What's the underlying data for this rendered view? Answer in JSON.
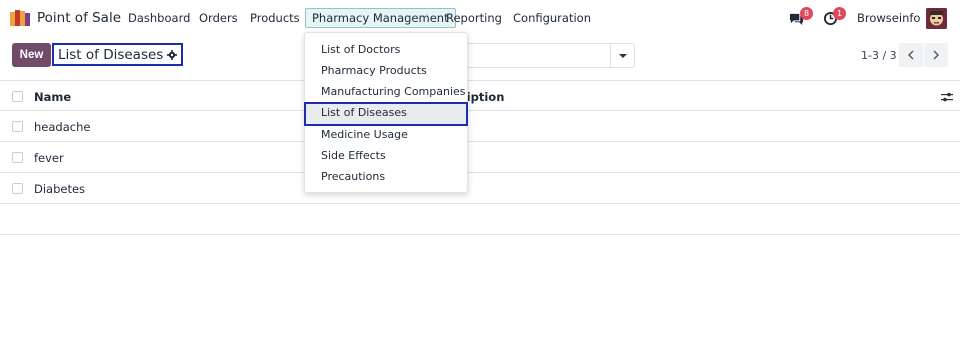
{
  "app": {
    "name": "Point of Sale"
  },
  "menu": {
    "items": [
      "Dashboard",
      "Orders",
      "Products",
      "Pharmacy Management",
      "Reporting",
      "Configuration"
    ],
    "active": "Pharmacy Management"
  },
  "systray": {
    "messages_count": "8",
    "activity_count": "1",
    "user_name": "Browseinfo"
  },
  "control_panel": {
    "new_label": "New",
    "breadcrumb_title": "List of Diseases",
    "search_placeholder": "",
    "pager": "1-3 / 3"
  },
  "list": {
    "columns": [
      "Name",
      "Description"
    ],
    "rows": [
      {
        "name": "headache",
        "description": ""
      },
      {
        "name": "fever",
        "description": ""
      },
      {
        "name": "Diabetes",
        "description": ""
      }
    ]
  },
  "dropdown": {
    "items": [
      "List of Doctors",
      "Pharmacy Products",
      "Manufacturing Companies",
      "List of Diseases",
      "Medicine Usage",
      "Side Effects",
      "Precautions"
    ],
    "highlighted": "List of Diseases"
  },
  "colors": {
    "brand": "#714b67",
    "highlight_border": "#1f2cad",
    "badge": "#e0495c",
    "active_menu_bg": "#e6f4f4"
  }
}
